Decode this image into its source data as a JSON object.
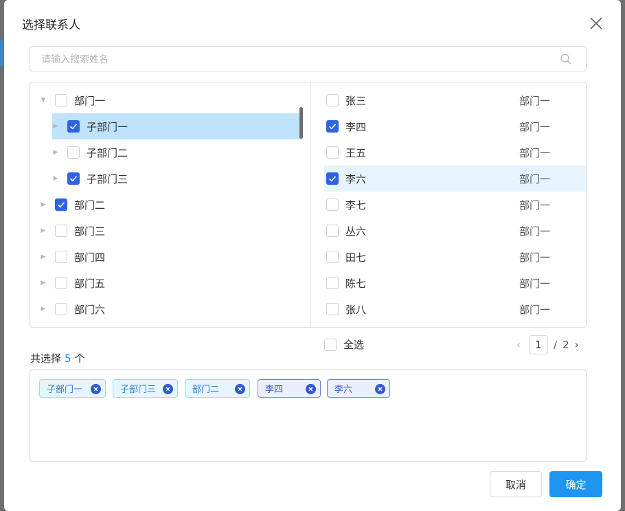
{
  "dialog": {
    "title": "选择联系人"
  },
  "search": {
    "placeholder": "请输入搜索姓名"
  },
  "tree": {
    "items": [
      {
        "label": "部门一",
        "checked": false,
        "expanded": true,
        "level": 0
      },
      {
        "label": "子部门一",
        "checked": true,
        "expanded": false,
        "level": 1,
        "selected": true
      },
      {
        "label": "子部门二",
        "checked": false,
        "expanded": false,
        "level": 1
      },
      {
        "label": "子部门三",
        "checked": true,
        "expanded": false,
        "level": 1
      },
      {
        "label": "部门二",
        "checked": true,
        "expanded": false,
        "level": 0
      },
      {
        "label": "部门三",
        "checked": false,
        "expanded": false,
        "level": 0
      },
      {
        "label": "部门四",
        "checked": false,
        "expanded": false,
        "level": 0
      },
      {
        "label": "部门五",
        "checked": false,
        "expanded": false,
        "level": 0
      },
      {
        "label": "部门六",
        "checked": false,
        "expanded": false,
        "level": 0
      }
    ]
  },
  "contacts": {
    "items": [
      {
        "name": "张三",
        "dept": "部门一",
        "checked": false
      },
      {
        "name": "李四",
        "dept": "部门一",
        "checked": true
      },
      {
        "name": "王五",
        "dept": "部门一",
        "checked": false
      },
      {
        "name": "李六",
        "dept": "部门一",
        "checked": true,
        "highlighted": true
      },
      {
        "name": "李七",
        "dept": "部门一",
        "checked": false
      },
      {
        "name": "丛六",
        "dept": "部门一",
        "checked": false
      },
      {
        "name": "田七",
        "dept": "部门一",
        "checked": false
      },
      {
        "name": "陈七",
        "dept": "部门一",
        "checked": false
      },
      {
        "name": "张八",
        "dept": "部门一",
        "checked": false
      }
    ],
    "select_all_label": "全选",
    "select_all_checked": false
  },
  "pagination": {
    "prev": "‹",
    "current": "1",
    "separator": "/",
    "total": "2",
    "next": "›"
  },
  "summary": {
    "prefix": "共选择",
    "count": "5",
    "suffix": "个"
  },
  "selected_tags": [
    {
      "label": "子部门一",
      "kind": "dept"
    },
    {
      "label": "子部门三",
      "kind": "dept"
    },
    {
      "label": "部门二",
      "kind": "dept"
    },
    {
      "label": "李四",
      "kind": "person"
    },
    {
      "label": "李六",
      "kind": "person"
    }
  ],
  "buttons": {
    "cancel": "取消",
    "ok": "确定"
  },
  "colors": {
    "accent": "#1e95f0",
    "checkbox": "#2f63e3",
    "tree_selected_bg": "#bee3fb",
    "row_highlight_bg": "#e6f4fd"
  },
  "icons": {
    "close": "close-icon",
    "search": "search-icon",
    "tag_remove": "close-circle-icon",
    "expand": "caret-right-icon",
    "collapse": "caret-down-icon"
  }
}
